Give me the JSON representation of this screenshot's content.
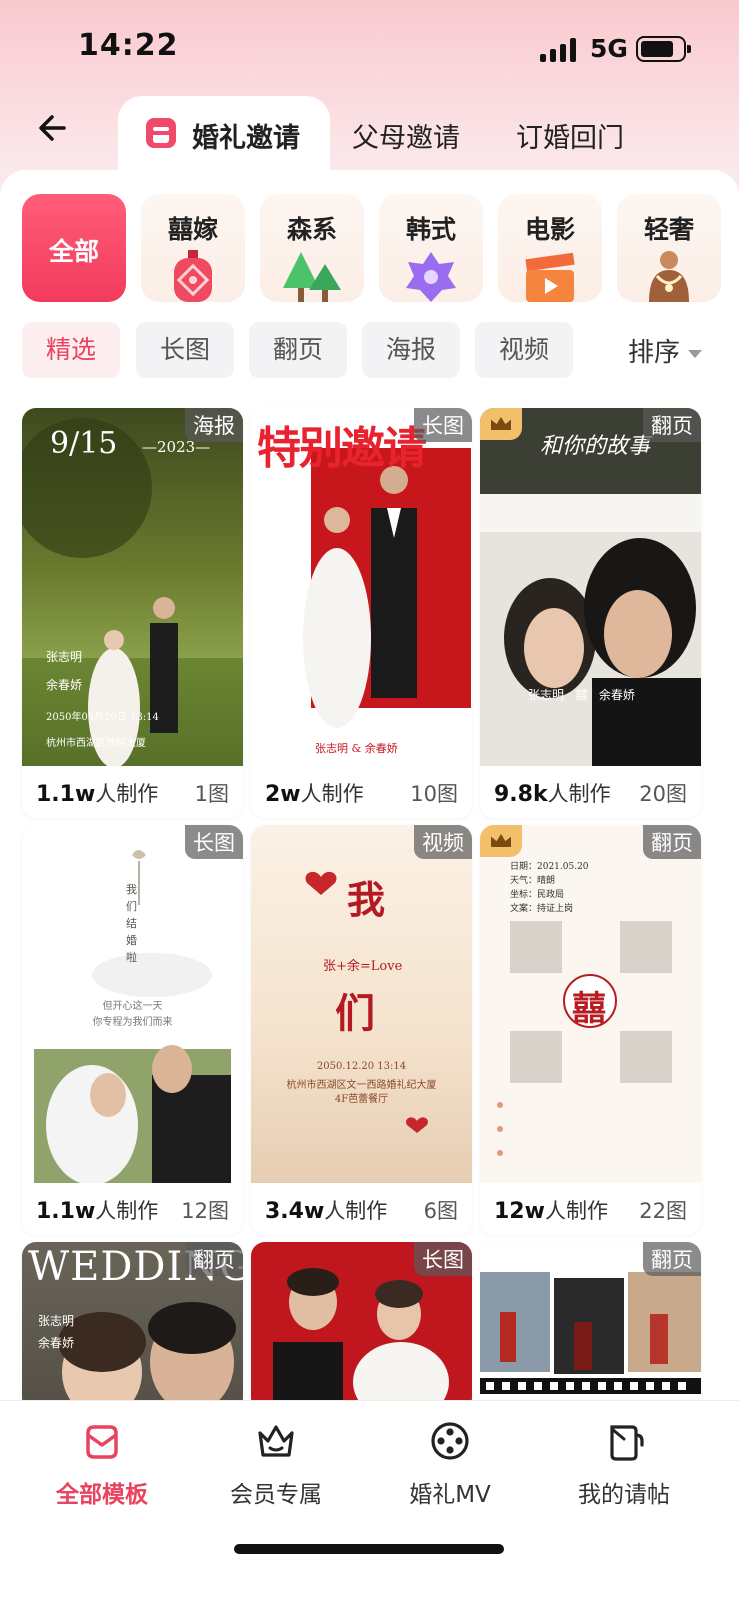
{
  "status": {
    "time": "14:22",
    "network": "5G"
  },
  "header": {
    "tabs": [
      {
        "label": "婚礼邀请",
        "active": true
      },
      {
        "label": "父母邀请",
        "active": false
      },
      {
        "label": "订婚回门",
        "active": false
      }
    ]
  },
  "categories": [
    {
      "label": "全部",
      "active": true,
      "icon": "all"
    },
    {
      "label": "囍嫁",
      "active": false,
      "icon": "red-lantern-icon"
    },
    {
      "label": "森系",
      "active": false,
      "icon": "trees-icon"
    },
    {
      "label": "韩式",
      "active": false,
      "icon": "flower-icon"
    },
    {
      "label": "电影",
      "active": false,
      "icon": "clapperboard-icon"
    },
    {
      "label": "轻奢",
      "active": false,
      "icon": "necklace-icon"
    }
  ],
  "filters": [
    {
      "label": "精选",
      "active": true
    },
    {
      "label": "长图",
      "active": false
    },
    {
      "label": "翻页",
      "active": false
    },
    {
      "label": "海报",
      "active": false
    },
    {
      "label": "视频",
      "active": false
    }
  ],
  "sort": {
    "label": "排序"
  },
  "cards": [
    {
      "tag": "海报",
      "vip": false,
      "count": "1.1w",
      "count_suffix": "人制作",
      "pics": "1图",
      "text": {
        "date": "9/15",
        "year": "—2023—",
        "groom": "张志明",
        "bride": "余春娇",
        "detail": "2050年05月20日 13:14",
        "place": "杭州市西湖区数娱大厦"
      }
    },
    {
      "tag": "长图",
      "vip": false,
      "count": "2w",
      "count_suffix": "人制作",
      "pics": "10图",
      "text": {
        "title": "特别邀请",
        "names": "张志明 & 余春娇"
      }
    },
    {
      "tag": "翻页",
      "vip": true,
      "count": "9.8k",
      "count_suffix": "人制作",
      "pics": "20图",
      "text": {
        "script": "和你的故事",
        "names": "张志明   囍   余春娇"
      }
    },
    {
      "tag": "长图",
      "vip": false,
      "count": "1.1w",
      "count_suffix": "人制作",
      "pics": "12图",
      "text": {
        "vertical": "我们结婚啦",
        "line1": "但开心这一天",
        "line2": "你专程为我们而来"
      }
    },
    {
      "tag": "视频",
      "vip": false,
      "count": "3.4w",
      "count_suffix": "人制作",
      "pics": "6图",
      "text": {
        "big1": "我",
        "big2": "们",
        "love": "张+余=Love",
        "date": "2050.12.20 13:14",
        "place": "杭州市西湖区文一西路婚礼纪大厦 4F芭蕾餐厅"
      }
    },
    {
      "tag": "翻页",
      "vip": true,
      "count": "12w",
      "count_suffix": "人制作",
      "pics": "22图",
      "text": {
        "l1": "日期：2021.05.20",
        "l2": "天气：晴朗",
        "l3": "坐标：民政局",
        "l4": "文案：持证上岗",
        "xi": "囍"
      }
    },
    {
      "tag": "翻页",
      "vip": false,
      "text": {
        "title": "WEDDING",
        "groom": "张志明",
        "bride": "余春娇"
      }
    },
    {
      "tag": "长图",
      "vip": false
    },
    {
      "tag": "翻页",
      "vip": false
    }
  ],
  "bottom_nav": [
    {
      "label": "全部模板",
      "active": true,
      "icon": "template-icon"
    },
    {
      "label": "会员专属",
      "active": false,
      "icon": "crown-icon"
    },
    {
      "label": "婚礼MV",
      "active": false,
      "icon": "film-reel-icon"
    },
    {
      "label": "我的请帖",
      "active": false,
      "icon": "invitation-icon"
    }
  ],
  "colors": {
    "accent": "#e8435f",
    "accent_bg": "#fdeef0"
  }
}
